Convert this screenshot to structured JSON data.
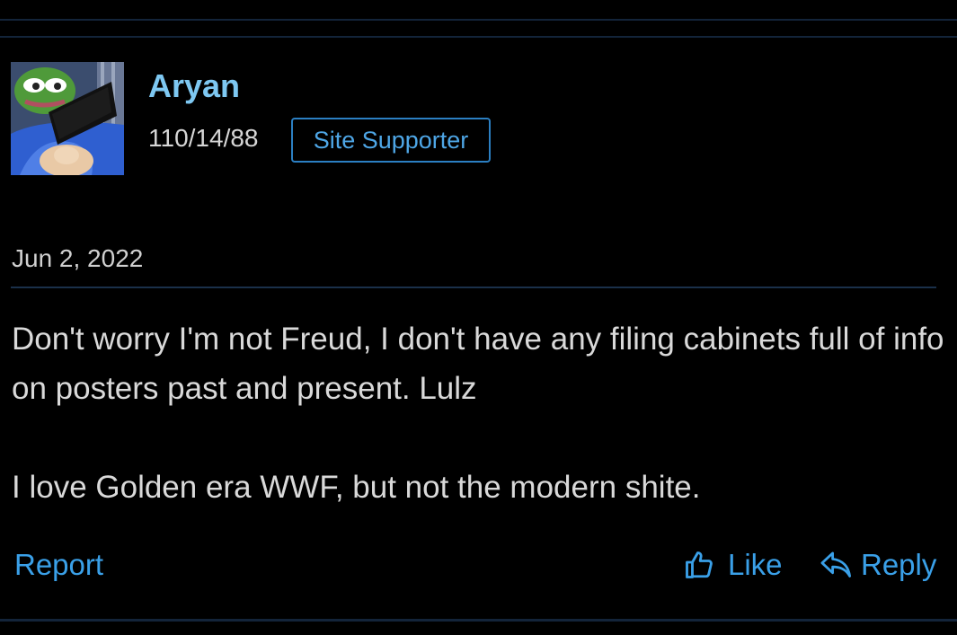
{
  "post": {
    "author": {
      "name": "Aryan",
      "meta": "110/14/88",
      "badge": "Site Supporter",
      "avatar_icon": "frog-avatar-icon"
    },
    "date": "Jun 2, 2022",
    "body": [
      "Don't worry I'm not Freud, I don't have any filing cabinets full of info on posters past and present. Lulz",
      "I love Golden era WWF, but not the modern shite."
    ],
    "actions": {
      "report": "Report",
      "like": "Like",
      "reply": "Reply"
    }
  },
  "colors": {
    "background": "#000000",
    "accent": "#3aa0e8",
    "username": "#7ec8f2",
    "text": "#d9d9d9",
    "divider": "#13243a"
  }
}
